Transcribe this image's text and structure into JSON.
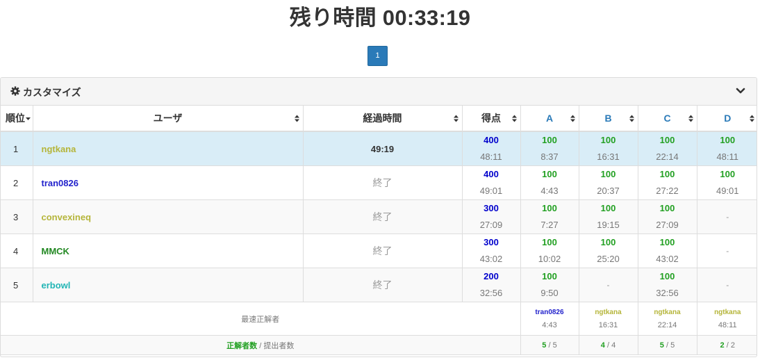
{
  "header": {
    "title": "残り時間 00:33:19"
  },
  "pagination": {
    "pages": [
      "1"
    ],
    "current": "1"
  },
  "panel": {
    "title": "カスタマイズ"
  },
  "table": {
    "columns": {
      "rank": "順位",
      "user": "ユーザ",
      "elapsed": "経過時間",
      "score": "得点",
      "problems": [
        "A",
        "B",
        "C",
        "D"
      ]
    },
    "rows": [
      {
        "rank": "1",
        "user": "ngtkana",
        "user_color": "#b5b53a",
        "elapsed": "49:19",
        "running": true,
        "score": "400",
        "score_time": "48:11",
        "cells": [
          {
            "v": "100",
            "t": "8:37"
          },
          {
            "v": "100",
            "t": "16:31"
          },
          {
            "v": "100",
            "t": "22:14"
          },
          {
            "v": "100",
            "t": "48:11"
          }
        ]
      },
      {
        "rank": "2",
        "user": "tran0826",
        "user_color": "#2222cc",
        "elapsed": "終了",
        "running": false,
        "score": "400",
        "score_time": "49:01",
        "cells": [
          {
            "v": "100",
            "t": "4:43"
          },
          {
            "v": "100",
            "t": "20:37"
          },
          {
            "v": "100",
            "t": "27:22"
          },
          {
            "v": "100",
            "t": "49:01"
          }
        ]
      },
      {
        "rank": "3",
        "user": "convexineq",
        "user_color": "#b5b53a",
        "elapsed": "終了",
        "running": false,
        "score": "300",
        "score_time": "27:09",
        "cells": [
          {
            "v": "100",
            "t": "7:27"
          },
          {
            "v": "100",
            "t": "19:15"
          },
          {
            "v": "100",
            "t": "27:09"
          },
          {
            "dash": "-"
          }
        ]
      },
      {
        "rank": "4",
        "user": "MMCK",
        "user_color": "#228822",
        "elapsed": "終了",
        "running": false,
        "score": "300",
        "score_time": "43:02",
        "cells": [
          {
            "v": "100",
            "t": "10:02"
          },
          {
            "v": "100",
            "t": "25:20"
          },
          {
            "v": "100",
            "t": "43:02"
          },
          {
            "dash": "-"
          }
        ]
      },
      {
        "rank": "5",
        "user": "erbowl",
        "user_color": "#22b5b5",
        "elapsed": "終了",
        "running": false,
        "score": "200",
        "score_time": "32:56",
        "cells": [
          {
            "v": "100",
            "t": "9:50"
          },
          {
            "dash": "-"
          },
          {
            "v": "100",
            "t": "32:56"
          },
          {
            "dash": "-"
          }
        ]
      }
    ],
    "fastest": {
      "label": "最速正解者",
      "items": [
        {
          "name": "tran0826",
          "color": "#2222cc",
          "time": "4:43"
        },
        {
          "name": "ngtkana",
          "color": "#b5b53a",
          "time": "16:31"
        },
        {
          "name": "ngtkana",
          "color": "#b5b53a",
          "time": "22:14"
        },
        {
          "name": "ngtkana",
          "color": "#b5b53a",
          "time": "48:11"
        }
      ]
    },
    "stats": {
      "label_ac": "正解者数",
      "label_sep": " / ",
      "label_sub": "提出者数",
      "items": [
        {
          "ac": "5",
          "sep": " / ",
          "sub": "5"
        },
        {
          "ac": "4",
          "sep": " / ",
          "sub": "4"
        },
        {
          "ac": "5",
          "sep": " / ",
          "sub": "5"
        },
        {
          "ac": "2",
          "sep": " / ",
          "sub": "2"
        }
      ]
    }
  },
  "colors": {
    "accent": "#2a7ab8",
    "highlight_row": "#d9edf7",
    "ac_green": "#22a022",
    "score_blue": "#0000cc"
  },
  "icons": {
    "settings": "gear-icon",
    "collapse": "chevron-down-icon",
    "sort": "sort-icon",
    "sort_active": "sort-down-icon"
  }
}
